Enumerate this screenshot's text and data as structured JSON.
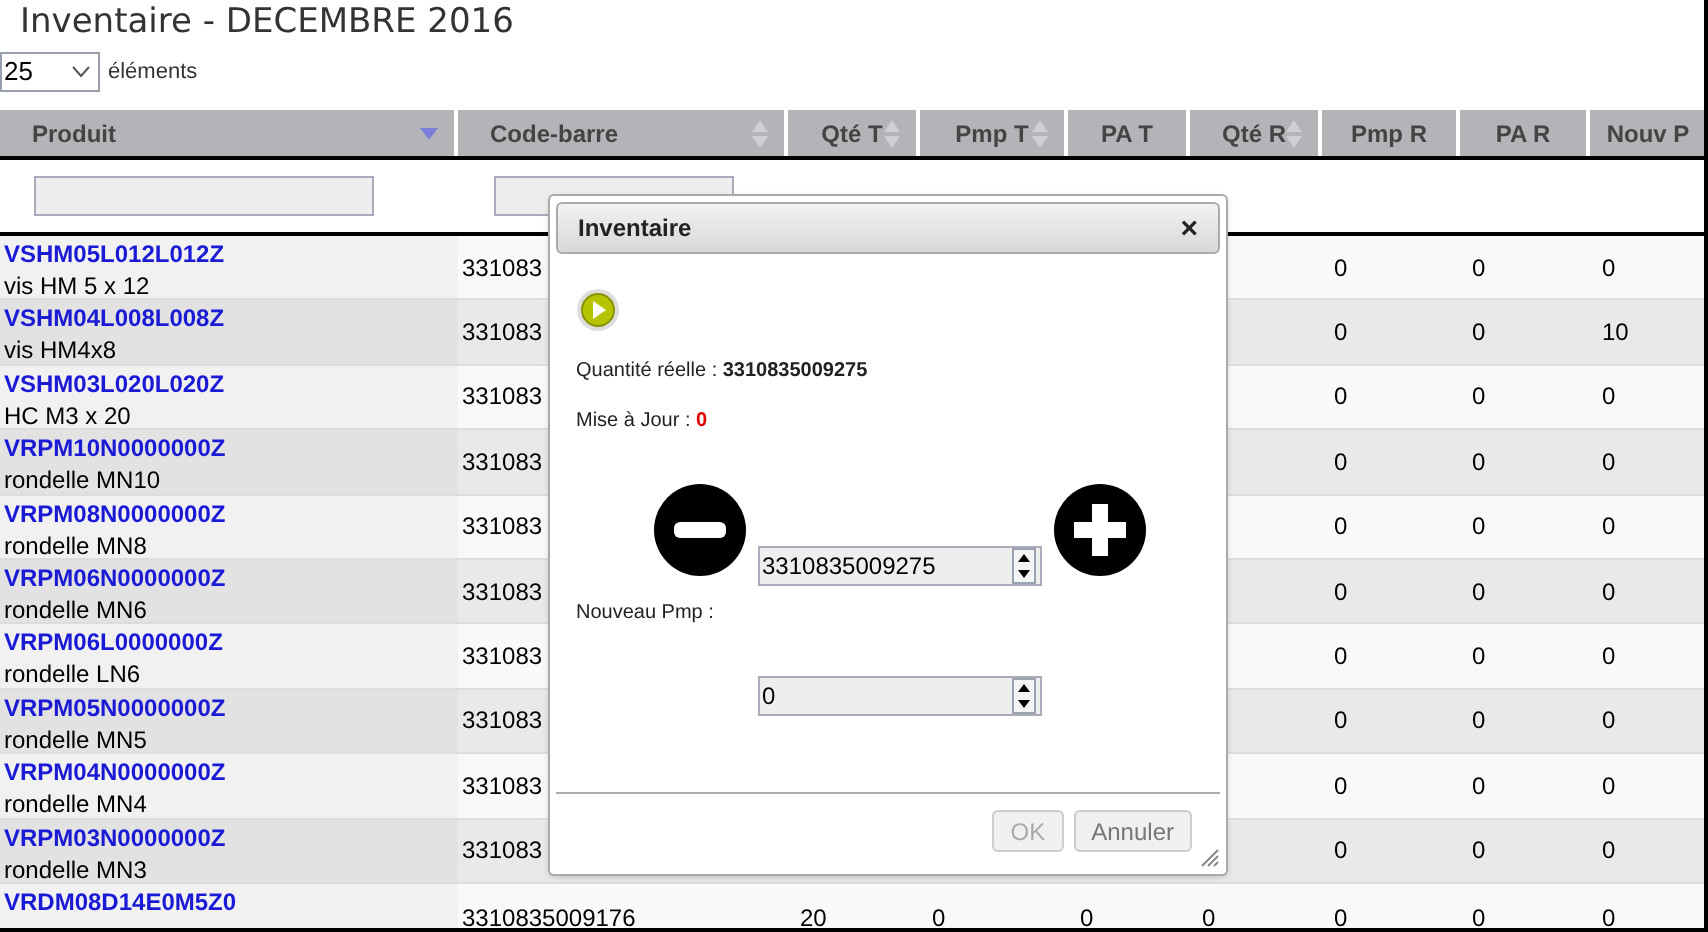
{
  "title": "Inventaire - DECEMBRE 2016",
  "page_length": {
    "value": "25",
    "label": "éléments"
  },
  "columns": [
    {
      "label": "Produit",
      "sortable": true,
      "sorted": true
    },
    {
      "label": "Code-barre",
      "sortable": true,
      "sorted": false
    },
    {
      "label": "Qté T",
      "sortable": true,
      "sorted": false
    },
    {
      "label": "Pmp T",
      "sortable": true,
      "sorted": false
    },
    {
      "label": "PA T",
      "sortable": false
    },
    {
      "label": "Qté R",
      "sortable": true,
      "sorted": false
    },
    {
      "label": "Pmp R",
      "sortable": false
    },
    {
      "label": "PA R",
      "sortable": false
    },
    {
      "label": "Nouv P",
      "sortable": false
    }
  ],
  "rows": [
    {
      "code": "VSHM05L012L012Z",
      "name": "vis HM 5 x 12",
      "cells": [
        "331083",
        null,
        null,
        null,
        null,
        "0",
        "0",
        "0"
      ]
    },
    {
      "code": "VSHM04L008L008Z",
      "name": "vis HM4x8",
      "cells": [
        "331083",
        null,
        null,
        null,
        null,
        "0",
        "0",
        "10"
      ]
    },
    {
      "code": "VSHM03L020L020Z",
      "name": "HC M3 x 20",
      "cells": [
        "331083",
        null,
        null,
        null,
        null,
        "0",
        "0",
        "0"
      ]
    },
    {
      "code": "VRPM10N0000000Z",
      "name": "rondelle MN10",
      "cells": [
        "331083",
        null,
        null,
        null,
        null,
        "0",
        "0",
        "0"
      ]
    },
    {
      "code": "VRPM08N0000000Z",
      "name": "rondelle MN8",
      "cells": [
        "331083",
        null,
        null,
        null,
        null,
        "0",
        "0",
        "0"
      ]
    },
    {
      "code": "VRPM06N0000000Z",
      "name": "rondelle MN6",
      "cells": [
        "331083",
        null,
        null,
        null,
        null,
        "0",
        "0",
        "0"
      ]
    },
    {
      "code": "VRPM06L0000000Z",
      "name": "rondelle LN6",
      "cells": [
        "331083",
        null,
        null,
        null,
        null,
        "0",
        "0",
        "0"
      ]
    },
    {
      "code": "VRPM05N0000000Z",
      "name": "rondelle MN5",
      "cells": [
        "331083",
        null,
        null,
        null,
        null,
        "0",
        "0",
        "0"
      ]
    },
    {
      "code": "VRPM04N0000000Z",
      "name": "rondelle MN4",
      "cells": [
        "331083",
        null,
        null,
        null,
        null,
        "0",
        "0",
        "0"
      ]
    },
    {
      "code": "VRPM03N0000000Z",
      "name": "rondelle MN3",
      "cells": [
        "331083",
        null,
        null,
        null,
        null,
        "0",
        "0",
        "0"
      ]
    },
    {
      "code": "VRDM08D14E0M5Z0",
      "cells": [
        "3310835009176",
        "20",
        "0",
        "0",
        "0",
        "0",
        "0",
        "0"
      ]
    }
  ],
  "dialog": {
    "title": "Inventaire",
    "close": "×",
    "qty_label": "Quantité réelle : ",
    "qty_value": "3310835009275",
    "update_label": "Mise à Jour : ",
    "update_value": "0",
    "qty_field": "3310835009275",
    "pmp_label": "Nouveau Pmp :",
    "pmp_field": "0",
    "buttons": [
      {
        "label": "OK",
        "disabled": true
      },
      {
        "label": "Annuler",
        "disabled": false
      }
    ]
  }
}
